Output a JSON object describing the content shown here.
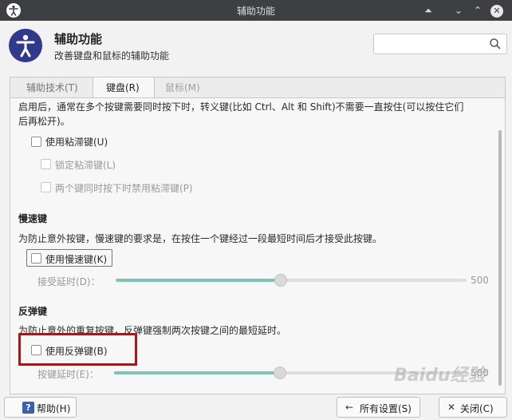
{
  "window": {
    "title": "辅助功能",
    "controls": [
      "minimize",
      "restore",
      "maximize",
      "close"
    ]
  },
  "header": {
    "title": "辅助功能",
    "subtitle": "改善键盘和鼠标的辅助功能",
    "search_placeholder": ""
  },
  "tabs": [
    {
      "label": "辅助技术(T)",
      "active": false
    },
    {
      "label": "键盘(R)",
      "active": true
    },
    {
      "label": "鼠标(M)",
      "active": false
    }
  ],
  "sticky_keys": {
    "description_line1": "启用后，通常在多个按键需要同时按下时，转义键(比如 Ctrl、Alt 和 Shift)不需要一直按住(可以按住它们",
    "description_line2": "后再松开)。",
    "enable_label": "使用粘滞键(U)",
    "lock_label": "锁定粘滞键(L)",
    "disable_two_keys_label": "两个键同时按下时禁用粘滞键(P)"
  },
  "slow_keys": {
    "heading": "慢速键",
    "description": "为防止意外按键，慢速键的要求是，在按住一个键经过一段最短时间后才接受此按键。",
    "enable_label": "使用慢速键(K)",
    "delay_label": "接受延时(D)：",
    "delay_value": "500",
    "delay_fraction": 0.47
  },
  "bounce_keys": {
    "heading": "反弹键",
    "description": "为防止意外的重复按键，反弹键强制两次按键之间的最短延时。",
    "enable_label": "使用反弹键(B)",
    "delay_label": "按键延时(E)：",
    "delay_value": "500",
    "delay_fraction": 0.47
  },
  "footer": {
    "help_label": "帮助(H)",
    "all_settings_label": "所有设置(S)",
    "close_label": "关闭(C)"
  },
  "watermark": "Baidu经验"
}
